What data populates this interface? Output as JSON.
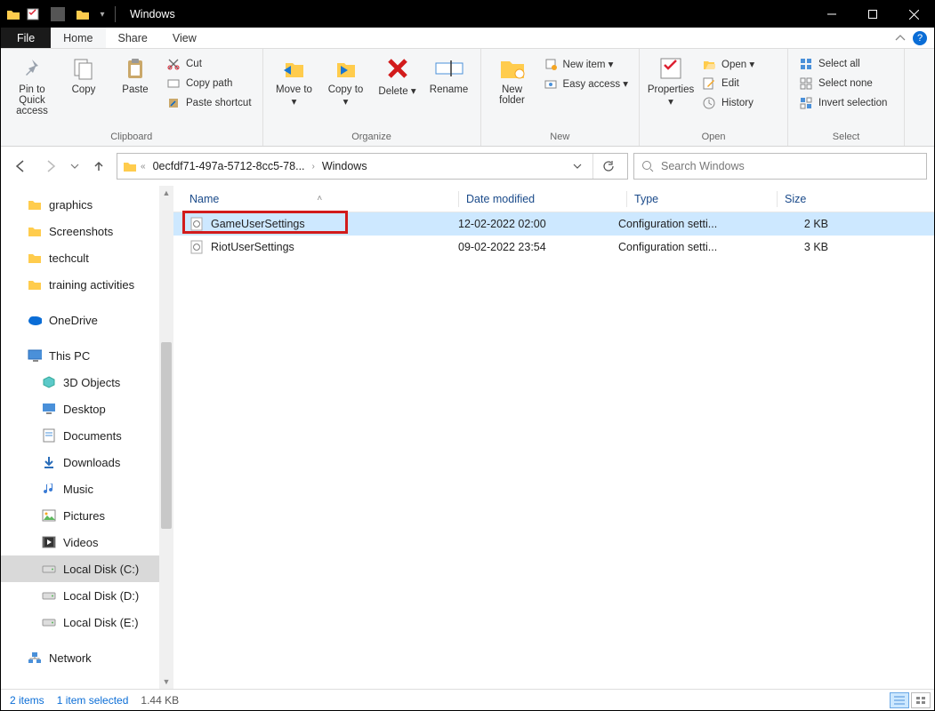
{
  "titlebar": {
    "title": "Windows"
  },
  "tabs": {
    "file": "File",
    "home": "Home",
    "share": "Share",
    "view": "View"
  },
  "ribbon": {
    "clipboard": {
      "label": "Clipboard",
      "pin": "Pin to Quick access",
      "copy": "Copy",
      "paste": "Paste",
      "cut": "Cut",
      "copypath": "Copy path",
      "pasteshortcut": "Paste shortcut"
    },
    "organize": {
      "label": "Organize",
      "moveto": "Move to",
      "copyto": "Copy to",
      "delete": "Delete",
      "rename": "Rename"
    },
    "new": {
      "label": "New",
      "newfolder": "New folder",
      "newitem": "New item",
      "easyaccess": "Easy access"
    },
    "open": {
      "label": "Open",
      "properties": "Properties",
      "open": "Open",
      "edit": "Edit",
      "history": "History"
    },
    "select": {
      "label": "Select",
      "all": "Select all",
      "none": "Select none",
      "invert": "Invert selection"
    }
  },
  "address": {
    "crumb1": "0ecfdf71-497a-5712-8cc5-78...",
    "crumb2": "Windows"
  },
  "search": {
    "placeholder": "Search Windows"
  },
  "columns": {
    "name": "Name",
    "date": "Date modified",
    "type": "Type",
    "size": "Size"
  },
  "files": [
    {
      "name": "GameUserSettings",
      "date": "12-02-2022 02:00",
      "type": "Configuration setti...",
      "size": "2 KB",
      "selected": true,
      "highlight": true
    },
    {
      "name": "RiotUserSettings",
      "date": "09-02-2022 23:54",
      "type": "Configuration setti...",
      "size": "3 KB"
    }
  ],
  "tree": [
    {
      "label": "graphics",
      "icon": "folder"
    },
    {
      "label": "Screenshots",
      "icon": "folder"
    },
    {
      "label": "techcult",
      "icon": "folder"
    },
    {
      "label": "training activities",
      "icon": "folder",
      "truncated": true
    },
    {
      "label": "OneDrive",
      "icon": "onedrive",
      "spacer": true
    },
    {
      "label": "This PC",
      "icon": "thispc",
      "spacer": true
    },
    {
      "label": "3D Objects",
      "icon": "3d",
      "lvl": 2
    },
    {
      "label": "Desktop",
      "icon": "desktop",
      "lvl": 2
    },
    {
      "label": "Documents",
      "icon": "documents",
      "lvl": 2
    },
    {
      "label": "Downloads",
      "icon": "downloads",
      "lvl": 2
    },
    {
      "label": "Music",
      "icon": "music",
      "lvl": 2
    },
    {
      "label": "Pictures",
      "icon": "pictures",
      "lvl": 2
    },
    {
      "label": "Videos",
      "icon": "videos",
      "lvl": 2
    },
    {
      "label": "Local Disk (C:)",
      "icon": "disk",
      "lvl": 2,
      "selected": true
    },
    {
      "label": "Local Disk (D:)",
      "icon": "disk",
      "lvl": 2
    },
    {
      "label": "Local Disk (E:)",
      "icon": "disk",
      "lvl": 2
    },
    {
      "label": "Network",
      "icon": "network",
      "spacer": true
    }
  ],
  "status": {
    "items": "2 items",
    "selected": "1 item selected",
    "size": "1.44 KB"
  }
}
